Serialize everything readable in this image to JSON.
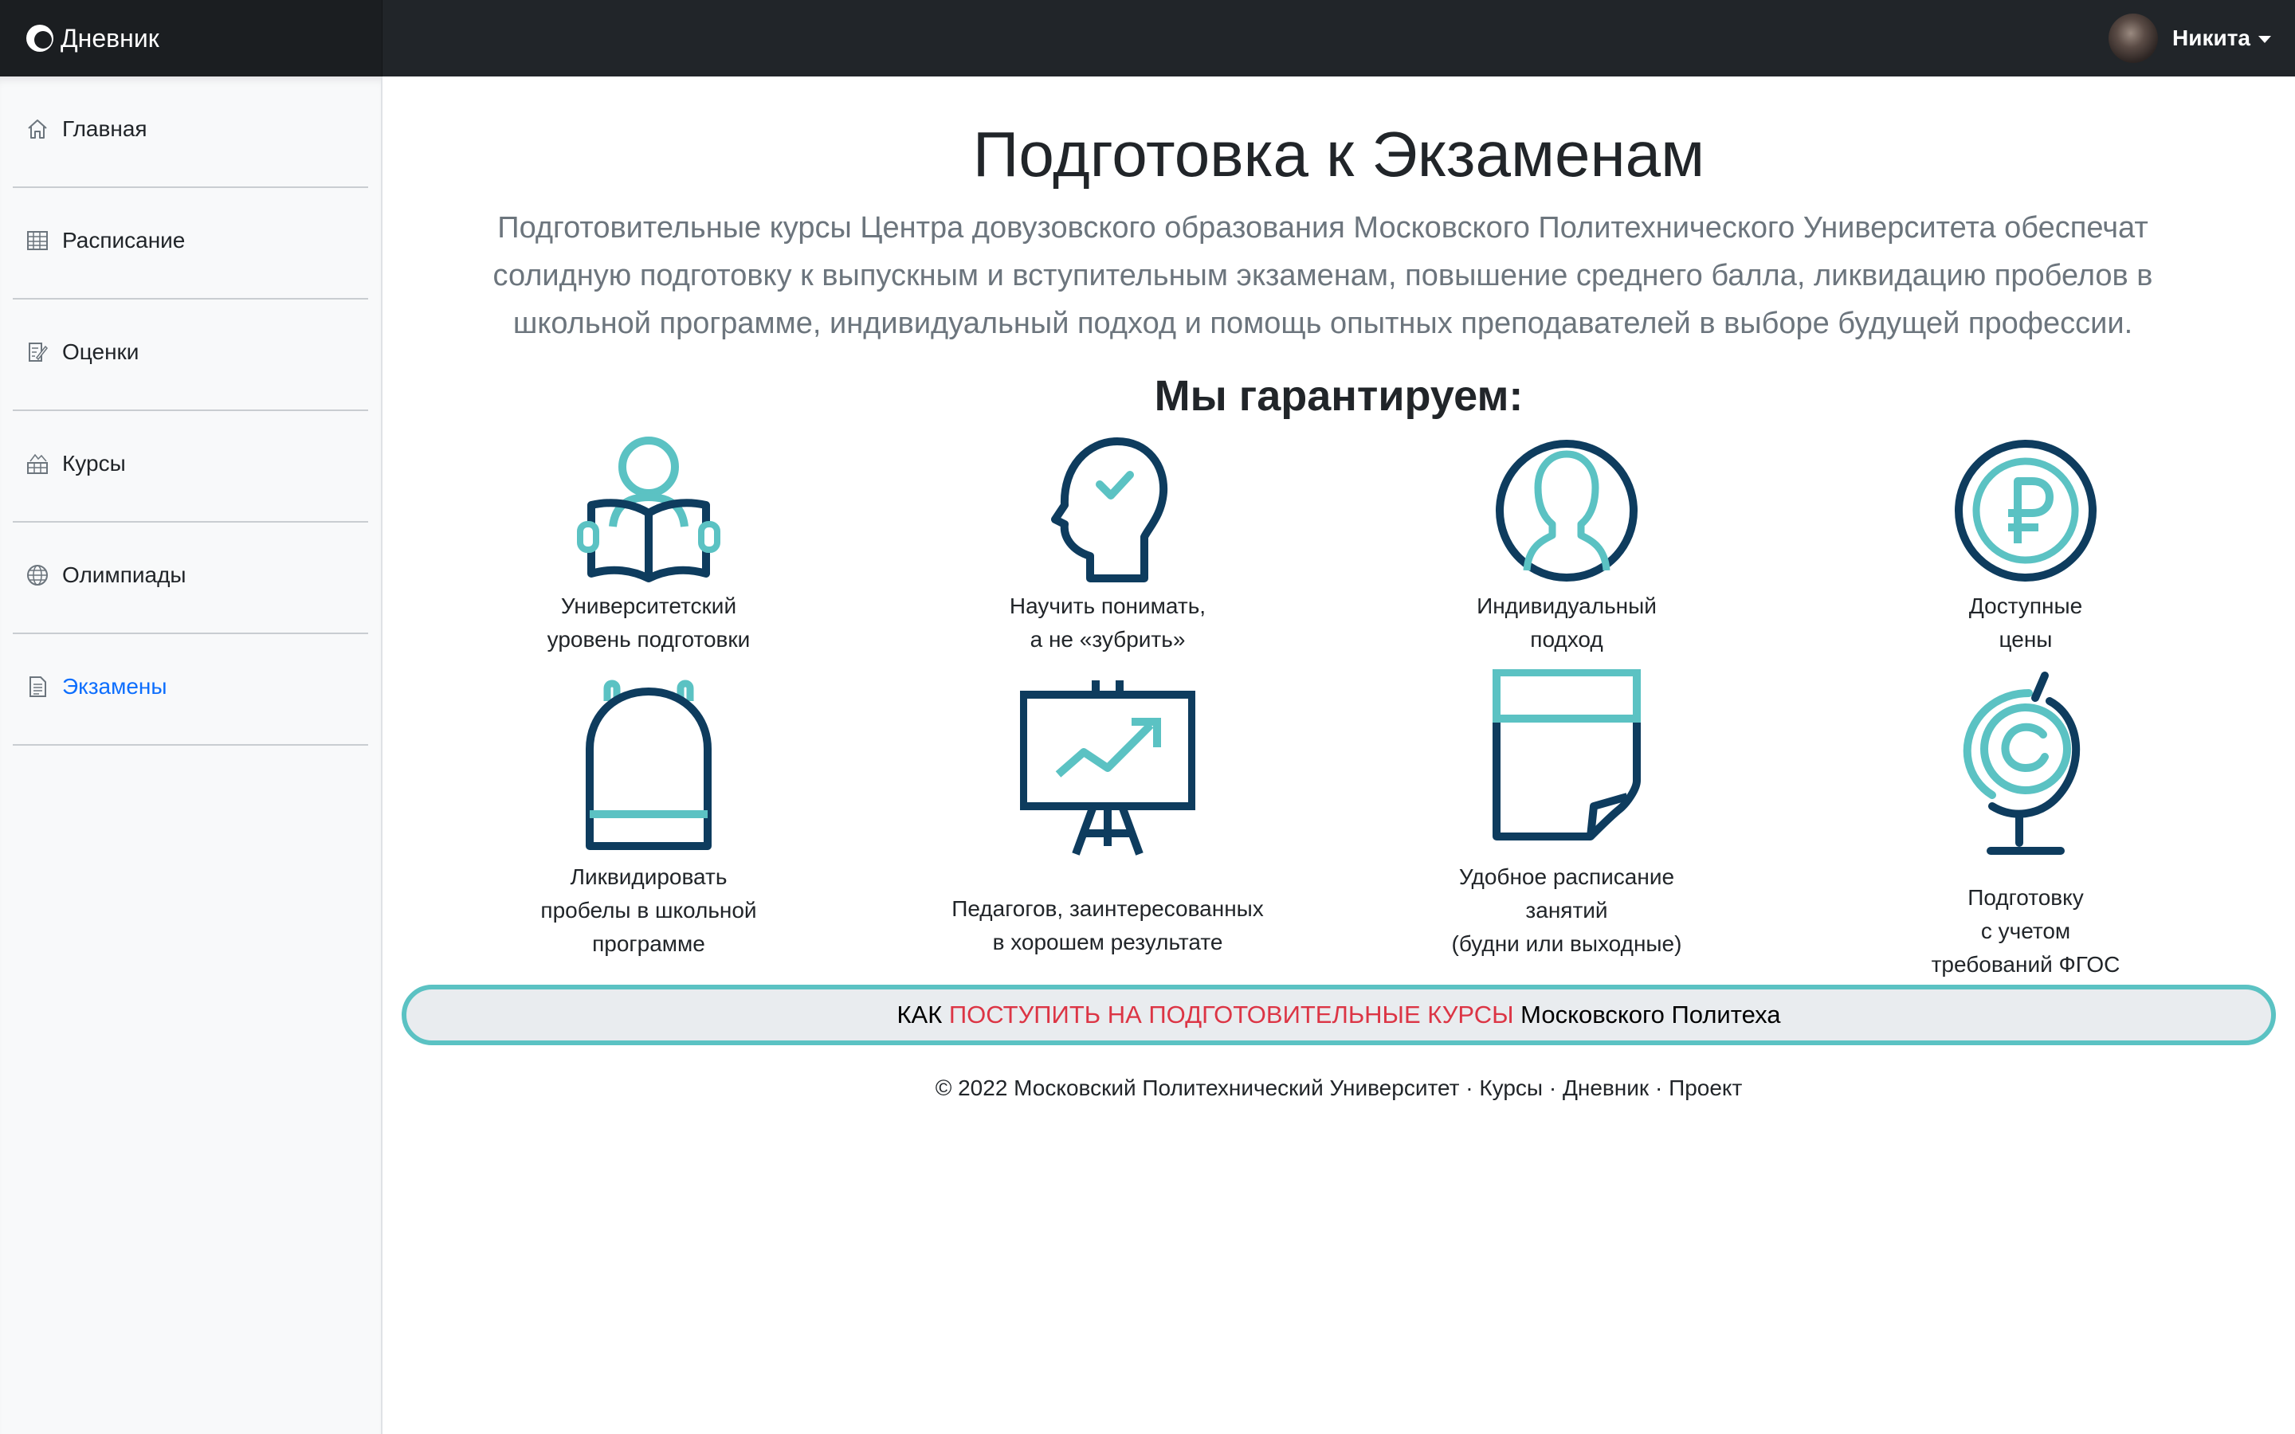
{
  "app": {
    "brand": "Дневник"
  },
  "user": {
    "name": "Никита"
  },
  "sidebar": {
    "items": [
      {
        "label": "Главная",
        "icon": "home-icon",
        "active": false
      },
      {
        "label": "Расписание",
        "icon": "calendar-table-icon",
        "active": false
      },
      {
        "label": "Оценки",
        "icon": "document-edit-icon",
        "active": false
      },
      {
        "label": "Курсы",
        "icon": "courses-icon",
        "active": false
      },
      {
        "label": "Олимпиады",
        "icon": "globe-icon",
        "active": false
      },
      {
        "label": "Экзамены",
        "icon": "exam-document-icon",
        "active": true
      }
    ]
  },
  "main": {
    "title": "Подготовка к Экзаменам",
    "lead": "Подготовительные курсы Центра довузовского образования Московского Политехнического Университета обеспечат солидную подготовку к выпускным и вступительным экзаменам, повышение среднего балла, ликвидацию пробелов в школьной программе, индивидуальный подход и помощь опытных преподавателей в выборе будущей профессии.",
    "guarantee_heading": "Мы гарантируем:",
    "features": [
      {
        "label": "Университетский\nуровень подготовки",
        "icon": "reading-student-icon"
      },
      {
        "label": "Научить понимать,\nа не «зубрить»",
        "icon": "head-check-icon"
      },
      {
        "label": "Индивидуальный\nподход",
        "icon": "person-profile-icon"
      },
      {
        "label": "Доступные\nцены",
        "icon": "ruble-coin-icon"
      },
      {
        "label": "Ликвидировать\nпробелы в школьной\nпрограмме",
        "icon": "backpack-icon"
      },
      {
        "label": "Педагогов, заинтересованных\nв хорошем результате",
        "icon": "chart-easel-icon"
      },
      {
        "label": "Удобное расписание\nзанятий\n(будни или выходные)",
        "icon": "note-page-icon"
      },
      {
        "label": "Подготовку\nс учетом\nтребований ФГОС",
        "icon": "globe-stand-icon"
      }
    ],
    "admission": {
      "prefix": "КАК ",
      "highlight": "ПОСТУПИТЬ НА ПОДГОТОВИТЕЛЬНЫЕ КУРСЫ",
      "suffix": " Московского Политеха"
    }
  },
  "footer": {
    "copyright": "© 2022 Московский Политехнический Университет",
    "separator": " · ",
    "links": [
      "Курсы",
      "Дневник",
      "Проект"
    ]
  },
  "colors": {
    "navbar": "#212529",
    "navy": "#0e3c5e",
    "teal": "#5bc2c3",
    "active_link": "#0d6efd",
    "accent_red": "#dc3545"
  }
}
